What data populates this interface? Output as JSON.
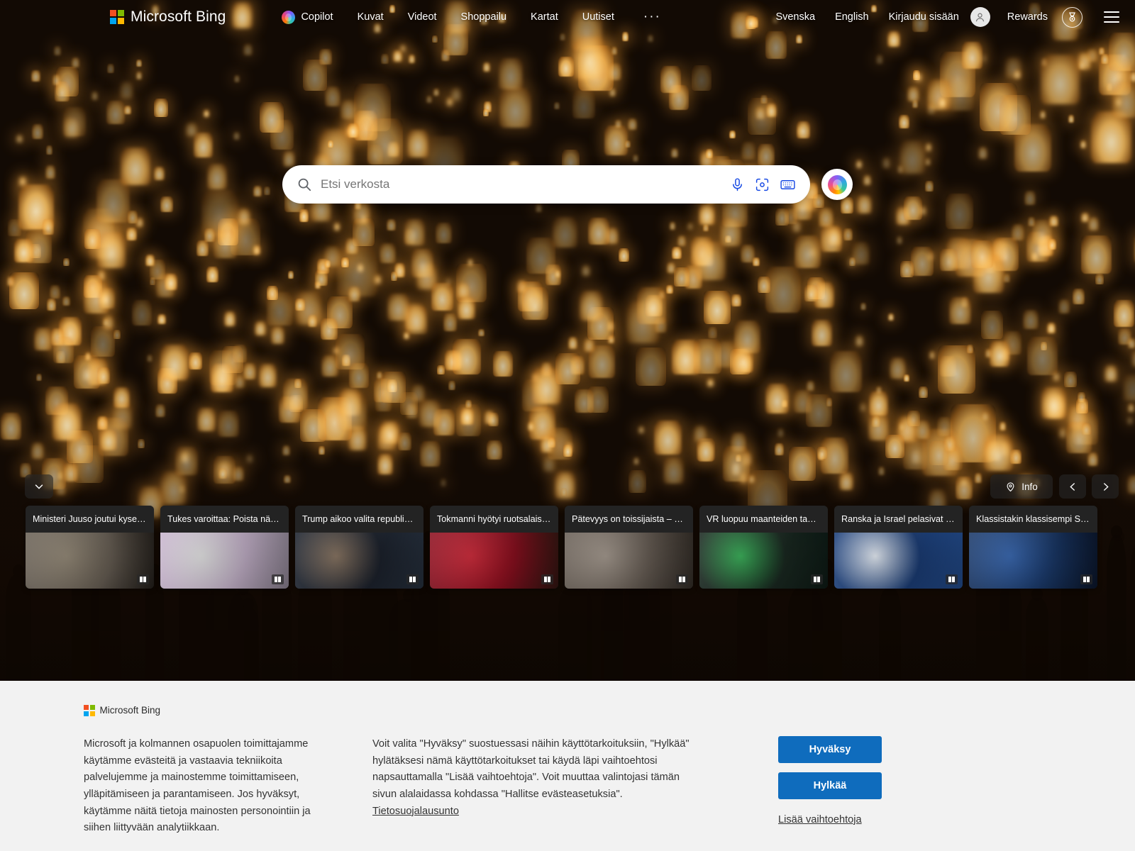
{
  "header": {
    "brand": "Microsoft Bing",
    "nav": [
      {
        "label": "Copilot",
        "icon": "copilot-icon"
      },
      {
        "label": "Kuvat",
        "icon": ""
      },
      {
        "label": "Videot",
        "icon": ""
      },
      {
        "label": "Shoppailu",
        "icon": ""
      },
      {
        "label": "Kartat",
        "icon": ""
      },
      {
        "label": "Uutiset",
        "icon": ""
      }
    ],
    "overflow": "···",
    "right": [
      {
        "label": "Svenska"
      },
      {
        "label": "English"
      },
      {
        "label": "Kirjaudu sisään"
      }
    ],
    "rewards_label": "Rewards",
    "account_icon": "person-icon",
    "rewards_icon": "medal-icon",
    "menu_icon": "hamburger-icon"
  },
  "search": {
    "placeholder": "Etsi verkosta",
    "value": "",
    "search_icon": "search-icon",
    "mic_icon": "microphone-icon",
    "lens_icon": "visual-search-icon",
    "keyboard_icon": "keyboard-icon",
    "copilot_icon": "copilot-icon"
  },
  "hero": {
    "info_label": "Info",
    "info_icon": "location-pin-icon",
    "prev_icon": "chevron-left-icon",
    "next_icon": "chevron-right-icon",
    "expand_icon": "chevron-down-icon"
  },
  "news": {
    "cards": [
      {
        "title": "Ministeri Juuso joutui kyse…",
        "badge": "book-icon"
      },
      {
        "title": "Tukes varoittaa: Poista nä…",
        "badge": "book-icon"
      },
      {
        "title": "Trump aikoo valita republi…",
        "badge": "book-icon"
      },
      {
        "title": "Tokmanni hyötyi ruotsalais…",
        "badge": "book-icon"
      },
      {
        "title": "Pätevyys on toissijaista – …",
        "badge": "book-icon"
      },
      {
        "title": "VR luopuu maanteiden ta…",
        "badge": "book-icon"
      },
      {
        "title": "Ranska ja Israel pelasivat …",
        "badge": "book-icon"
      },
      {
        "title": "Klassistakin klassisempi S…",
        "badge": "book-icon"
      }
    ]
  },
  "consent": {
    "brand": "Microsoft Bing",
    "paragraph_1": "Microsoft ja kolmannen osapuolen toimittajamme käytämme evästeitä ja vastaavia tekniikoita palvelujemme ja mainostemme toimittamiseen, ylläpitämiseen ja parantamiseen. Jos hyväksyt, käytämme näitä tietoja mainosten personointiin ja siihen liittyvään analytiikkaan.",
    "paragraph_2": "Voit valita \"Hyväksy\" suostuessasi näihin käyttötarkoituksiin, \"Hylkää\" hylätäksesi nämä käyttötarkoitukset tai käydä läpi vaihtoehtosi napsauttamalla \"Lisää vaihtoehtoja\". Voit muuttaa valintojasi tämän sivun alalaidassa kohdassa \"Hallitse evästeasetuksia\". ",
    "privacy_link": "Tietosuojalausunto",
    "accept_label": "Hyväksy",
    "reject_label": "Hylkää",
    "more_options_label": "Lisää vaihtoehtoja"
  },
  "colors": {
    "accent_blue": "#0f6cbd",
    "search_icon_blue": "#174ae4",
    "banner_bg": "#f2f2f2",
    "card_overlay": "rgba(38,38,38,0.80)"
  }
}
